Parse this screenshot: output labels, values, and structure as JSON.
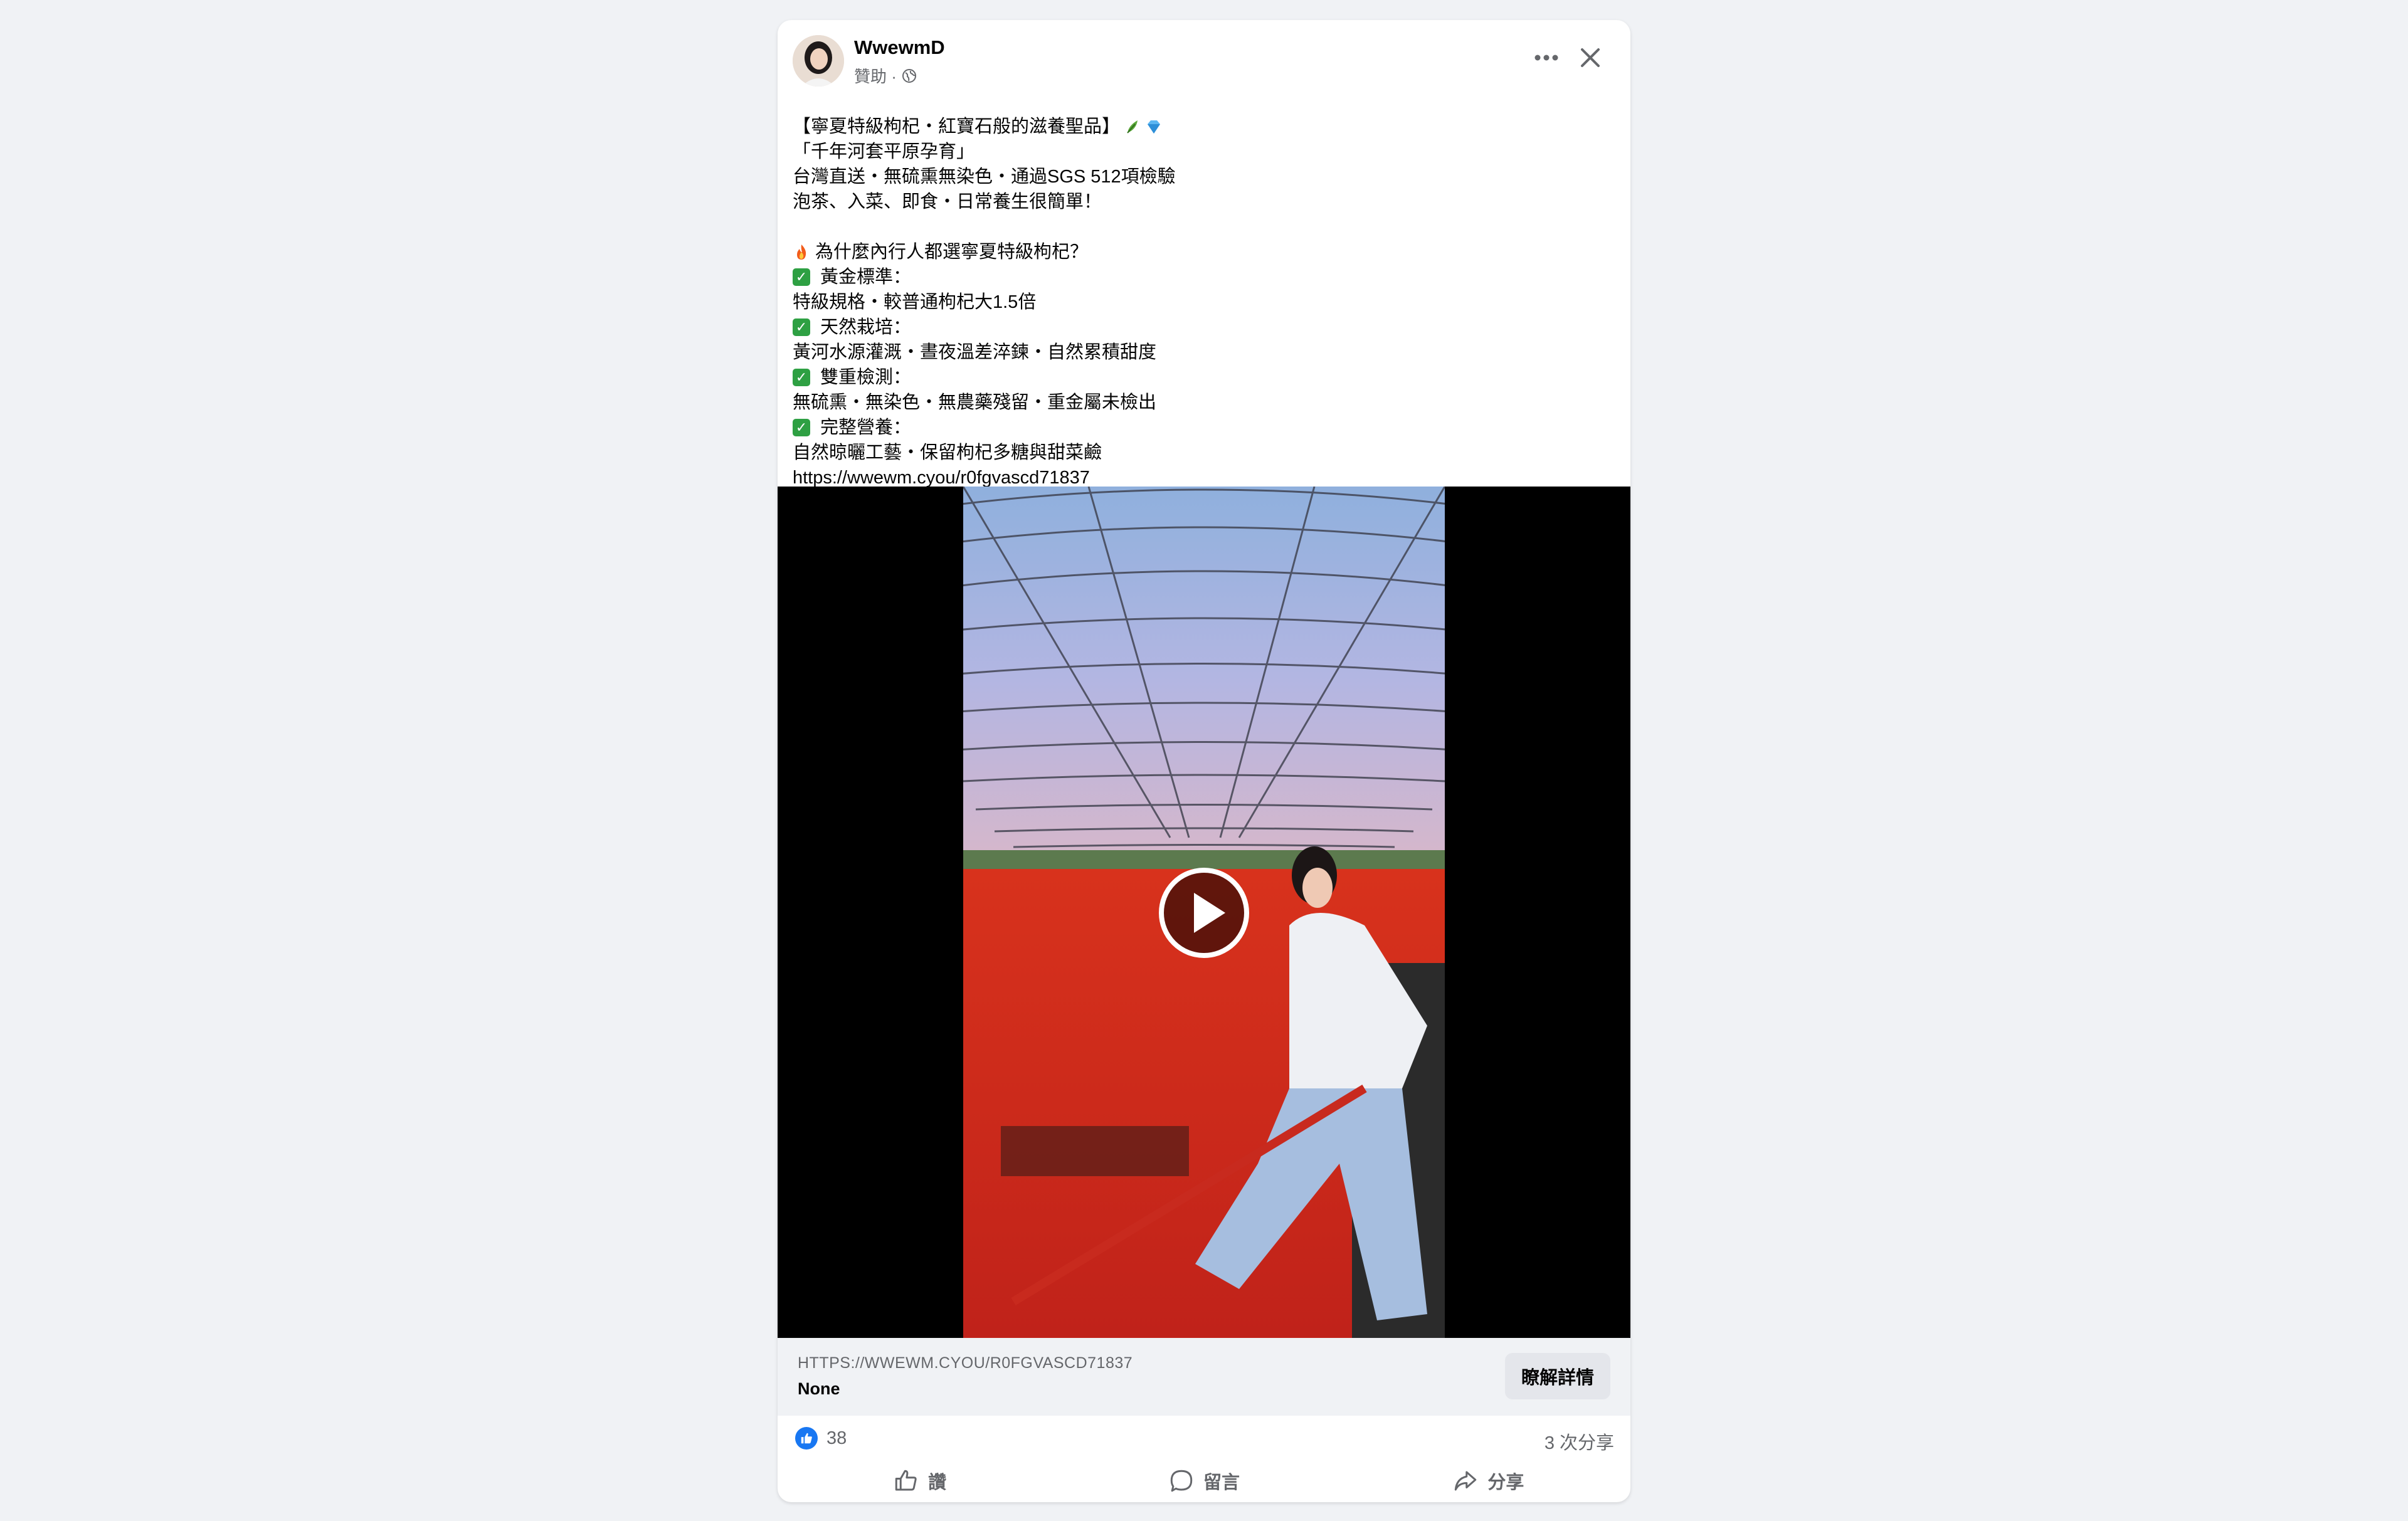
{
  "post": {
    "page_name": "WwewmD",
    "meta_label": "贊助 ·",
    "lines": [
      {
        "type": "text",
        "text": "【寧夏特級枸杞・紅寶石般的滋養聖品】",
        "emojis": [
          "herb-icon",
          "gem-icon"
        ]
      },
      {
        "type": "text",
        "text": "「千年河套平原孕育」"
      },
      {
        "type": "text",
        "text": "台灣直送・無硫熏無染色・通過SGS 512項檢驗"
      },
      {
        "type": "text",
        "text": "泡茶、入菜、即食・日常養生很簡單！"
      },
      {
        "type": "blank"
      },
      {
        "type": "fire",
        "text": "為什麼內行人都選寧夏特級枸杞？"
      },
      {
        "type": "check",
        "text": "黃金標準："
      },
      {
        "type": "text",
        "text": "特級規格・較普通枸杞大1.5倍"
      },
      {
        "type": "check",
        "text": "天然栽培："
      },
      {
        "type": "text",
        "text": "黃河水源灌溉・晝夜溫差淬鍊・自然累積甜度"
      },
      {
        "type": "check",
        "text": "雙重檢測："
      },
      {
        "type": "text",
        "text": "無硫熏・無染色・無農藥殘留・重金屬未檢出"
      },
      {
        "type": "check",
        "text": "完整營養："
      },
      {
        "type": "text",
        "text": "自然晾曬工藝・保留枸杞多糖與甜菜鹼"
      },
      {
        "type": "text",
        "text": "https://wwewm.cyou/r0fgvascd71837"
      }
    ]
  },
  "link": {
    "url": "HTTPS://WWEWM.CYOU/R0FGVASCD71837",
    "title": "None",
    "cta_label": "瞭解詳情"
  },
  "stats": {
    "like_count": "38",
    "share_count": "3 次分享"
  },
  "actions": {
    "like_label": "讚",
    "comment_label": "留言",
    "share_label": "分享"
  },
  "colors": {
    "brand_blue": "#1877f2",
    "check_green": "#2ea043",
    "background": "#f0f2f5"
  }
}
